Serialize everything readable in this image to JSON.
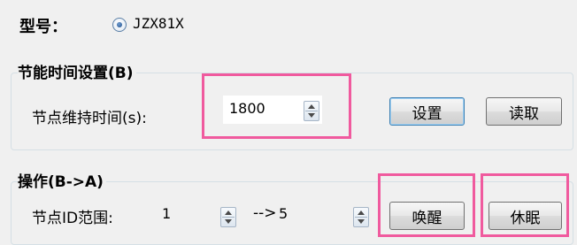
{
  "model": {
    "label": "型号：",
    "value": "JZX81X"
  },
  "energy_group": {
    "title": "节能时间设置(B)",
    "hold_time_label": "节点维持时间(s):",
    "hold_time_value": "1800",
    "set_button": "设置",
    "read_button": "读取"
  },
  "operation_group": {
    "title": "操作(B->A)",
    "node_range_label": "节点ID范围:",
    "range_start": "1",
    "arrow": "-->",
    "range_end": "5",
    "wake_button": "唤醒",
    "sleep_button": "休眠"
  },
  "colors": {
    "highlight": "#f05a9e",
    "group_border": "#d5dfe5"
  }
}
